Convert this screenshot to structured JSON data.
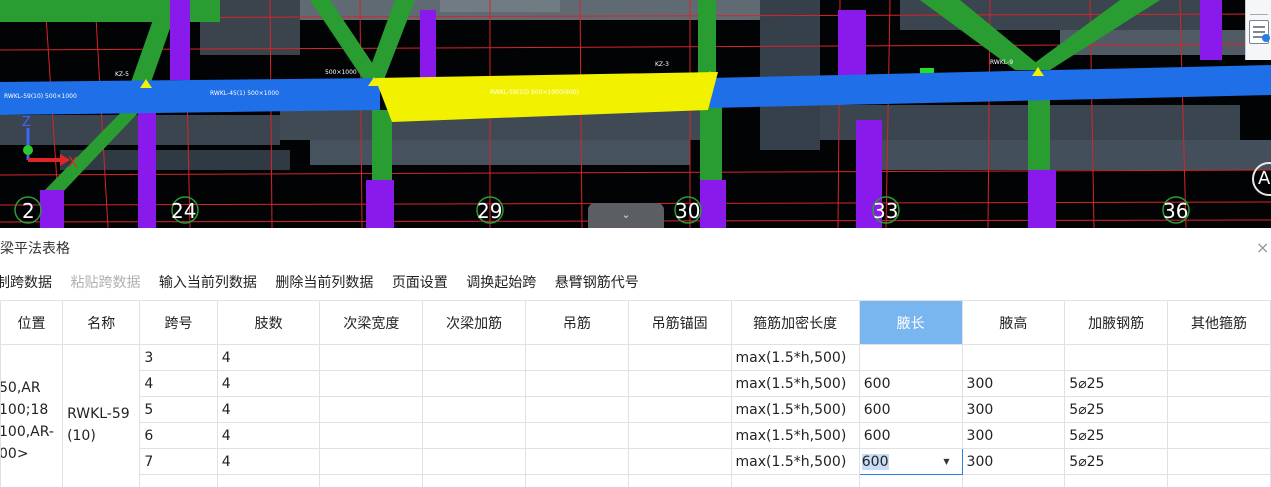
{
  "viewport": {
    "axis_numbers": [
      "2",
      "24",
      "29",
      "30",
      "33",
      "36"
    ],
    "axis_letter": "A",
    "coord_axis": {
      "x_label": "X",
      "z_label": "Z"
    },
    "colors": {
      "background": "#020305",
      "beam": "#1f6fe8",
      "selected_beam": "#f2f200",
      "column": "#8a19ec",
      "brace": "#2a9d32",
      "grid_line": "#d7242a"
    }
  },
  "panel": {
    "title": "梁平法表格",
    "close_icon": "×"
  },
  "toolbar": {
    "items": [
      {
        "label": "制跨数据",
        "enabled": true
      },
      {
        "label": "粘贴跨数据",
        "enabled": false
      },
      {
        "label": "输入当前列数据",
        "enabled": true
      },
      {
        "label": "删除当前列数据",
        "enabled": true
      },
      {
        "label": "页面设置",
        "enabled": true
      },
      {
        "label": "调换起始跨",
        "enabled": true
      },
      {
        "label": "悬臂钢筋代号",
        "enabled": true
      }
    ]
  },
  "table": {
    "columns": [
      "位置",
      "名称",
      "跨号",
      "肢数",
      "次梁宽度",
      "次梁加筋",
      "吊筋",
      "吊筋锚固",
      "箍筋加密长度",
      "腋长",
      "腋高",
      "加腋钢筋",
      "其他箍筋"
    ],
    "active_column": "腋长",
    "location": "50,AR\n100;18\n100,AR-\n00>",
    "name": "RWKL-59\n(10)",
    "rows": [
      {
        "span": "3",
        "legs": "4",
        "dense_length": "max(1.5*h,500)",
        "haunch_length": "",
        "haunch_height": "",
        "haunch_rebar": ""
      },
      {
        "span": "4",
        "legs": "4",
        "dense_length": "max(1.5*h,500)",
        "haunch_length": "600",
        "haunch_height": "300",
        "haunch_rebar": "5⌀25"
      },
      {
        "span": "5",
        "legs": "4",
        "dense_length": "max(1.5*h,500)",
        "haunch_length": "600",
        "haunch_height": "300",
        "haunch_rebar": "5⌀25"
      },
      {
        "span": "6",
        "legs": "4",
        "dense_length": "max(1.5*h,500)",
        "haunch_length": "600",
        "haunch_height": "300",
        "haunch_rebar": "5⌀25"
      },
      {
        "span": "7",
        "legs": "4",
        "dense_length": "max(1.5*h,500)",
        "haunch_length": "600",
        "haunch_height": "300",
        "haunch_rebar": "5⌀25"
      },
      {
        "span": "",
        "legs": "",
        "dense_length": "",
        "haunch_length": "",
        "haunch_height": "",
        "haunch_rebar": ""
      }
    ]
  }
}
